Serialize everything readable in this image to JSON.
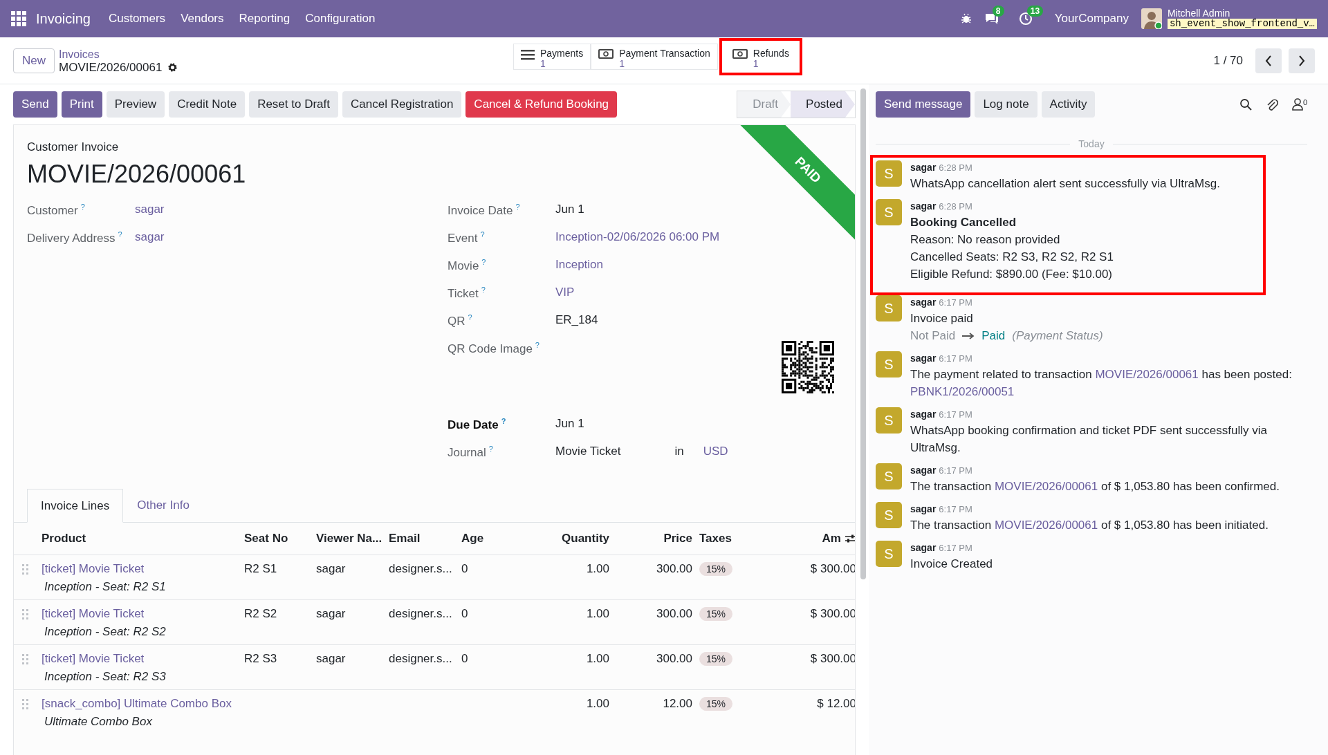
{
  "navbar": {
    "app": "Invoicing",
    "menus": [
      "Customers",
      "Vendors",
      "Reporting",
      "Configuration"
    ],
    "messages_count": "8",
    "activities_count": "13",
    "company": "YourCompany",
    "user": "Mitchell Admin",
    "database": "sh_event_show_frontend_v…"
  },
  "control_panel": {
    "new_button": "New",
    "breadcrumb": "Invoices",
    "record": "MOVIE/2026/00061",
    "smart_buttons": [
      {
        "kind": "list",
        "label": "Payments",
        "count": "1",
        "highlighted": false
      },
      {
        "kind": "money",
        "label": "Payment Transaction",
        "count": "1",
        "highlighted": false
      },
      {
        "kind": "money",
        "label": "Refunds",
        "count": "1",
        "highlighted": true
      }
    ],
    "pager": "1 / 70"
  },
  "actions": [
    {
      "label": "Send",
      "kind": "primary"
    },
    {
      "label": "Print",
      "kind": "primary"
    },
    {
      "label": "Preview",
      "kind": "secondary"
    },
    {
      "label": "Credit Note",
      "kind": "secondary"
    },
    {
      "label": "Reset to Draft",
      "kind": "secondary"
    },
    {
      "label": "Cancel Registration",
      "kind": "secondary"
    },
    {
      "label": "Cancel & Refund Booking",
      "kind": "danger"
    }
  ],
  "status_bar": [
    {
      "label": "Draft",
      "selected": false
    },
    {
      "label": "Posted",
      "selected": true
    }
  ],
  "sheet": {
    "subtitle": "Customer Invoice",
    "title": "MOVIE/2026/00061",
    "ribbon": "PAID",
    "left_fields": [
      {
        "label": "Customer",
        "help": "?",
        "kind": "link",
        "value": "sagar",
        "emphasized": false
      },
      {
        "label": "Delivery Address",
        "help": "?",
        "kind": "link",
        "value": "sagar",
        "emphasized": false
      }
    ],
    "right_fields": [
      {
        "label": "Invoice Date",
        "help": "?",
        "kind": "text",
        "value": "Jun 1",
        "emphasized": false
      },
      {
        "label": "Event",
        "help": "?",
        "kind": "link",
        "value": "Inception-02/06/2026 06:00 PM",
        "emphasized": false
      },
      {
        "label": "Movie",
        "help": "?",
        "kind": "link",
        "value": "Inception",
        "emphasized": false
      },
      {
        "label": "Ticket",
        "help": "?",
        "kind": "link",
        "value": "VIP",
        "emphasized": false
      },
      {
        "label": "QR",
        "help": "?",
        "kind": "text",
        "value": "ER_184",
        "emphasized": false
      },
      {
        "label": "QR Code Image",
        "help": "?",
        "kind": "image",
        "emphasized": false
      },
      {
        "label": "Due Date",
        "help": "?",
        "kind": "text",
        "value": "Jun 1",
        "emphasized": true
      },
      {
        "label": "Journal",
        "help": "?",
        "kind": "journal",
        "value": "Movie Ticket",
        "connector": "in",
        "currency": "USD",
        "emphasized": false
      }
    ],
    "tabs": [
      {
        "label": "Invoice Lines",
        "selected": true
      },
      {
        "label": "Other Info",
        "selected": false
      }
    ],
    "table": {
      "columns": [
        "Product",
        "Seat No",
        "Viewer Na...",
        "Email",
        "Age",
        "Quantity",
        "Price",
        "Taxes",
        "Am"
      ],
      "rows": [
        {
          "product": "[ticket] Movie Ticket",
          "description": "Inception - Seat: R2 S1",
          "seat": "R2 S1",
          "viewer": "sagar",
          "email": "designer.s...",
          "age": "0",
          "quantity": "1.00",
          "price": "300.00",
          "tax": "15%",
          "amount": "$ 300.00"
        },
        {
          "product": "[ticket] Movie Ticket",
          "description": "Inception - Seat: R2 S2",
          "seat": "R2 S2",
          "viewer": "sagar",
          "email": "designer.s...",
          "age": "0",
          "quantity": "1.00",
          "price": "300.00",
          "tax": "15%",
          "amount": "$ 300.00"
        },
        {
          "product": "[ticket] Movie Ticket",
          "description": "Inception - Seat: R2 S3",
          "seat": "R2 S3",
          "viewer": "sagar",
          "email": "designer.s...",
          "age": "0",
          "quantity": "1.00",
          "price": "300.00",
          "tax": "15%",
          "amount": "$ 300.00"
        },
        {
          "product": "[snack_combo] Ultimate Combo Box",
          "description": "Ultimate Combo Box",
          "quantity": "1.00",
          "price": "12.00",
          "tax": "15%",
          "amount": "$ 12.00"
        }
      ]
    }
  },
  "chatter": {
    "buttons": [
      {
        "label": "Send message",
        "kind": "primary"
      },
      {
        "label": "Log note",
        "kind": "secondary"
      },
      {
        "label": "Activity",
        "kind": "secondary"
      }
    ],
    "followers": "0",
    "day": "Today",
    "messages": [
      {
        "author": "sagar",
        "time": "6:28 PM",
        "initial": "S",
        "highlighted": true,
        "lines": [
          [
            {
              "text": "WhatsApp cancellation alert sent successfully via UltraMsg."
            }
          ]
        ]
      },
      {
        "author": "sagar",
        "time": "6:28 PM",
        "initial": "S",
        "highlighted": true,
        "title": "Booking Cancelled",
        "lines": [
          [
            {
              "text": "Reason: No reason provided"
            }
          ],
          [
            {
              "text": "Cancelled Seats: R2 S3, R2 S2, R2 S1"
            }
          ],
          [
            {
              "text": "Eligible Refund: $890.00 (Fee: $10.00)"
            }
          ]
        ]
      },
      {
        "author": "sagar",
        "time": "6:17 PM",
        "initial": "S",
        "highlighted": false,
        "lines": [
          [
            {
              "text": "Invoice paid"
            }
          ]
        ],
        "tracking": {
          "old": "Not Paid",
          "new": "Paid",
          "field": "(Payment Status)"
        }
      },
      {
        "author": "sagar",
        "time": "6:17 PM",
        "initial": "S",
        "highlighted": false,
        "lines": [
          [
            {
              "text": "The payment related to transaction "
            },
            {
              "link": "MOVIE/2026/00061"
            },
            {
              "text": " has been posted: "
            },
            {
              "link": "PBNK1/2026/00051"
            }
          ]
        ]
      },
      {
        "author": "sagar",
        "time": "6:17 PM",
        "initial": "S",
        "highlighted": false,
        "lines": [
          [
            {
              "text": "WhatsApp booking confirmation and ticket PDF sent successfully via UltraMsg."
            }
          ]
        ]
      },
      {
        "author": "sagar",
        "time": "6:17 PM",
        "initial": "S",
        "highlighted": false,
        "lines": [
          [
            {
              "text": "The transaction "
            },
            {
              "link": "MOVIE/2026/00061"
            },
            {
              "text": " of $ 1,053.80 has been confirmed."
            }
          ]
        ]
      },
      {
        "author": "sagar",
        "time": "6:17 PM",
        "initial": "S",
        "highlighted": false,
        "lines": [
          [
            {
              "text": "The transaction "
            },
            {
              "link": "MOVIE/2026/00061"
            },
            {
              "text": " of $ 1,053.80 has been initiated."
            }
          ]
        ]
      },
      {
        "author": "sagar",
        "time": "6:17 PM",
        "initial": "S",
        "highlighted": false,
        "lines": [
          [
            {
              "text": "Invoice Created"
            }
          ]
        ]
      }
    ]
  }
}
